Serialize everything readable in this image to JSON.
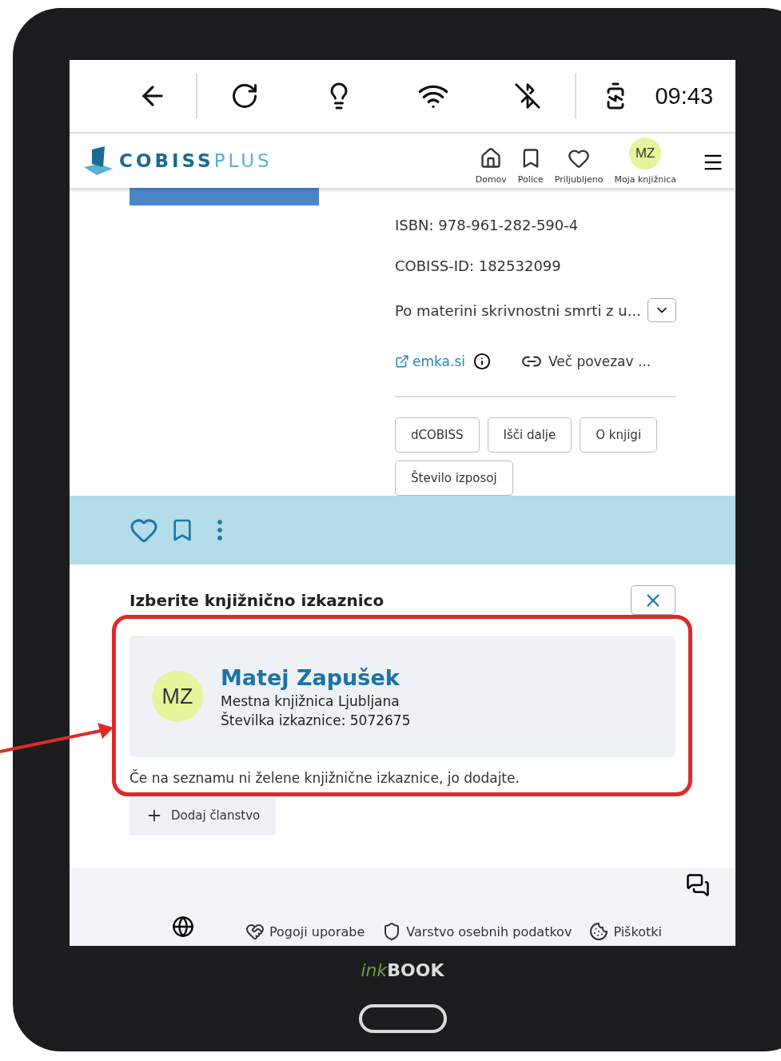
{
  "status_bar": {
    "time": "09:43"
  },
  "header": {
    "logo_main": "COBISS",
    "logo_sub": "PLUS",
    "nav": [
      {
        "label": "Domov"
      },
      {
        "label": "Police"
      },
      {
        "label": "Priljubljeno"
      },
      {
        "label": "Moja knjižnica",
        "avatar": "MZ"
      }
    ]
  },
  "record": {
    "isbn": "ISBN: 978-961-282-590-4",
    "cobiss_id": "COBISS-ID: 182532099",
    "series": "Po materini skrivnostni smrti z u...",
    "link": "emka.si",
    "more_links": "Več povezav ...",
    "buttons": [
      "dCOBISS",
      "Išči dalje",
      "O knjigi",
      "Število izposoj"
    ]
  },
  "modal": {
    "title": "Izberite knjižnično izkaznico",
    "card": {
      "initials": "MZ",
      "name": "Matej Zapušek",
      "library": "Mestna knjižnica Ljubljana",
      "card_number": "Številka izkaznice: 5072675"
    },
    "hint": "Če na seznamu ni želene knjižnične izkaznice, jo dodajte.",
    "add_button": "Dodaj članstvo"
  },
  "footer": {
    "links": [
      "Pogoji uporabe",
      "Varstvo osebnih podatkov",
      "Piškotki"
    ]
  },
  "device": {
    "brand_prefix": "ink",
    "brand_name": "BOOK"
  }
}
